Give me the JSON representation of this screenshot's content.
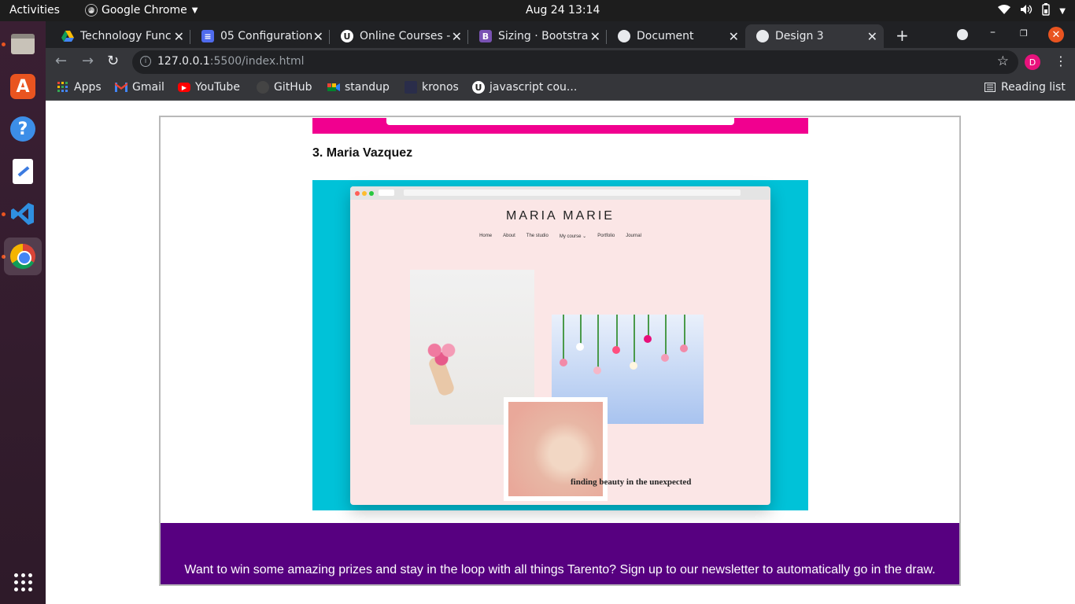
{
  "os": {
    "activities": "Activities",
    "app_name": "Google Chrome",
    "clock": "Aug 24  13:14"
  },
  "dock": {
    "items": [
      "files-icon",
      "app-store-icon",
      "help-icon",
      "text-editor-icon",
      "vscode-icon",
      "chrome-icon",
      "show-apps-icon"
    ]
  },
  "tabs": [
    {
      "title": "Technology Func",
      "icon": "google-drive-icon"
    },
    {
      "title": "05 Configuration",
      "icon": "docs-icon"
    },
    {
      "title": "Online Courses -",
      "icon": "udemy-icon"
    },
    {
      "title": "Sizing · Bootstra",
      "icon": "bootstrap-icon"
    },
    {
      "title": "Document",
      "icon": "globe-icon"
    },
    {
      "title": "Design 3",
      "icon": "globe-icon",
      "active": true
    }
  ],
  "toolbar": {
    "url_host": "127.0.0.1",
    "url_rest": ":5500/index.html"
  },
  "profile": {
    "initial": "D"
  },
  "bookmarks": [
    {
      "label": "Apps",
      "icon": "apps-grid-icon"
    },
    {
      "label": "Gmail",
      "icon": "gmail-icon"
    },
    {
      "label": "YouTube",
      "icon": "youtube-icon"
    },
    {
      "label": "GitHub",
      "icon": "github-icon"
    },
    {
      "label": "standup",
      "icon": "meet-icon"
    },
    {
      "label": "kronos",
      "icon": "kronos-icon"
    },
    {
      "label": "javascript cou...",
      "icon": "udemy-icon"
    }
  ],
  "reading_list": "Reading list",
  "page": {
    "item_title": "3. Maria Vazquez",
    "mock_site": {
      "brand": "MARIA MARIE",
      "nav": [
        "Home",
        "About",
        "The studio",
        "My course ⌄",
        "Portfolio",
        "Journal"
      ],
      "tagline": "finding beauty in the unexpected"
    },
    "newsletter_text": "Want to win some amazing prizes and stay in the loop with all things Tarento? Sign up to our newsletter to automatically go in the draw."
  },
  "colors": {
    "pink_strip": "#f1008f",
    "showcase_bg": "#00c2d8",
    "newsletter_bg": "#570080"
  }
}
